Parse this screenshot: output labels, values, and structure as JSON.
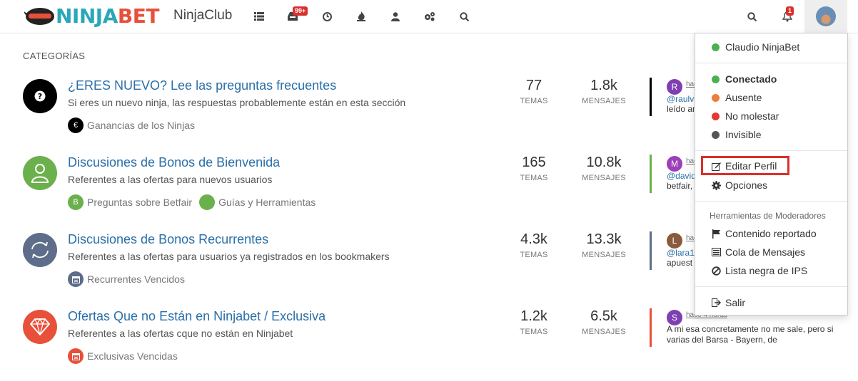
{
  "brand": {
    "logo_text_a": "NINJA",
    "logo_text_b": "BET",
    "club": "NinjaClub"
  },
  "nav": {
    "icons": [
      "list-icon",
      "inbox-icon",
      "clock-icon",
      "fire-icon",
      "user-icon",
      "cogs-icon",
      "search-icon"
    ],
    "unread_badge": "99+",
    "notifications_badge": "1"
  },
  "section_title": "CATEGORÍAS",
  "categories": [
    {
      "title": "¿ERES NUEVO? Lee las preguntas frecuentes",
      "description": "Si eres un nuevo ninja, las respuestas probablemente están en esta sección",
      "subcategories": [
        {
          "label": "Ganancias de los Ninjas",
          "icon": "euro-icon",
          "color": "#000000"
        }
      ],
      "topics": "77",
      "topics_label": "TEMAS",
      "posts": "1.8k",
      "posts_label": "MENSAJES",
      "teaser": {
        "avatar": "R",
        "avatar_color": "#7e3fb2",
        "time": "hac",
        "user": "@raulva",
        "text": "leído an",
        "bar_color": "#000000"
      },
      "icon_color": "#000000"
    },
    {
      "title": "Discusiones de Bonos de Bienvenida",
      "description": "Referentes a las ofertas para nuevos usuarios",
      "subcategories": [
        {
          "label": "Preguntas sobre Betfair",
          "icon": "B",
          "color": "#6ab04c"
        },
        {
          "label": "Guías y Herramientas",
          "icon": "",
          "color": "#6ab04c"
        }
      ],
      "topics": "165",
      "topics_label": "TEMAS",
      "posts": "10.8k",
      "posts_label": "MENSAJES",
      "teaser": {
        "avatar": "M",
        "avatar_color": "#9c3fb8",
        "time": "hac",
        "user": "@david",
        "text": "betfair,",
        "bar_color": "#6ab04c"
      },
      "icon_color": "#6ab04c"
    },
    {
      "title": "Discusiones de Bonos Recurrentes",
      "description": "Referentes a las ofertas para usuarios ya registrados en los bookmakers",
      "subcategories": [
        {
          "label": "Recurrentes Vencidos",
          "icon": "calendar-icon",
          "color": "#5d6d8a"
        }
      ],
      "topics": "4.3k",
      "topics_label": "TEMAS",
      "posts": "13.3k",
      "posts_label": "MENSAJES",
      "teaser": {
        "avatar": "L",
        "avatar_color": "#8a5a3c",
        "time": "hac",
        "user": "@lara13",
        "text": "apuest",
        "bar_color": "#5d6d8a"
      },
      "icon_color": "#5d6d8a"
    },
    {
      "title": "Ofertas Que no Están en Ninjabet / Exclusiva",
      "description": "Referentes a las ofertas cque no están en Ninjabet",
      "subcategories": [
        {
          "label": "Exclusivas Vencidas",
          "icon": "calendar-icon",
          "color": "#e8503a"
        }
      ],
      "topics": "1.2k",
      "topics_label": "TEMAS",
      "posts": "6.5k",
      "posts_label": "MENSAJES",
      "teaser": {
        "avatar": "S",
        "avatar_color": "#7e3fb2",
        "time": "hace 4 horas",
        "user": "",
        "text": "A mi esa concretamente no me sale, pero si varias del Barsa - Bayern, de",
        "bar_color": "#e8503a"
      },
      "icon_color": "#e8503a"
    }
  ],
  "dropdown": {
    "username": "Claudio NinjaBet",
    "status": [
      {
        "label": "Conectado",
        "color": "#4caf50"
      },
      {
        "label": "Ausente",
        "color": "#f07c3a"
      },
      {
        "label": "No molestar",
        "color": "#e53935"
      },
      {
        "label": "Invisible",
        "color": "#555555"
      }
    ],
    "edit_profile": "Editar Perfil",
    "options": "Opciones",
    "mod_header": "Herramientas de Moderadores",
    "reported": "Contenido reportado",
    "queue": "Cola de Mensajes",
    "ip_blacklist": "Lista negra de IPS",
    "logout": "Salir"
  }
}
